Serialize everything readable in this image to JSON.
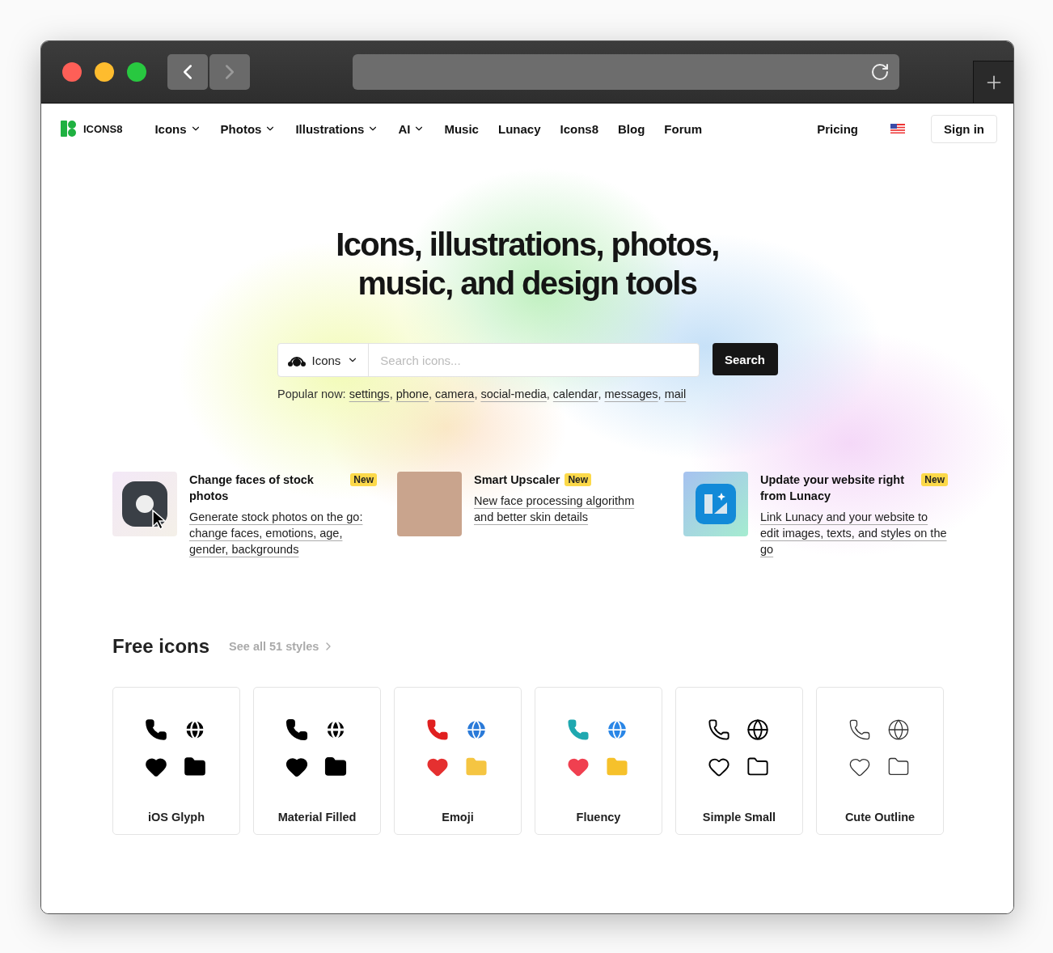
{
  "browser": {
    "back_enabled": true,
    "forward_enabled": false
  },
  "nav": {
    "logo": "ICONS8",
    "items": [
      {
        "label": "Icons",
        "has_menu": true
      },
      {
        "label": "Photos",
        "has_menu": true
      },
      {
        "label": "Illustrations",
        "has_menu": true
      },
      {
        "label": "AI",
        "has_menu": true
      },
      {
        "label": "Music",
        "has_menu": false
      },
      {
        "label": "Lunacy",
        "has_menu": false
      },
      {
        "label": "Icons8",
        "has_menu": false
      },
      {
        "label": "Blog",
        "has_menu": false
      },
      {
        "label": "Forum",
        "has_menu": false
      }
    ],
    "pricing": "Pricing",
    "sign_in": "Sign in"
  },
  "hero": {
    "title_lines": [
      "Icons, illustrations, photos,",
      "music, and design tools"
    ],
    "search": {
      "category": "Icons",
      "placeholder": "Search icons...",
      "button": "Search"
    },
    "popular_label": "Popular now:",
    "popular_separator": ",",
    "popular": [
      "settings",
      "phone",
      "camera",
      "social-media",
      "calendar",
      "messages",
      "mail"
    ]
  },
  "features": [
    {
      "kind": "app",
      "title": "Change faces of stock photos",
      "badge": "New",
      "description": "Generate stock photos on the go: change faces, emotions, age, gender, backgrounds"
    },
    {
      "kind": "photo",
      "title": "Smart Upscaler",
      "badge": "New",
      "description": "New face processing algorithm and better skin details"
    },
    {
      "kind": "lunacy",
      "title": "Update your website right from Lunacy",
      "badge": "New",
      "description": "Link Lunacy and your website to edit images, texts, and styles on the go"
    }
  ],
  "free_icons": {
    "title": "Free icons",
    "see_all": "See all 51 styles",
    "styles": [
      {
        "kind": "glyph",
        "name": "iOS Glyph"
      },
      {
        "kind": "material",
        "name": "Material Filled"
      },
      {
        "kind": "emoji",
        "name": "Emoji"
      },
      {
        "kind": "fluency",
        "name": "Fluency"
      },
      {
        "kind": "simple",
        "name": "Simple Small"
      },
      {
        "kind": "cute",
        "name": "Cute Outline"
      }
    ]
  }
}
